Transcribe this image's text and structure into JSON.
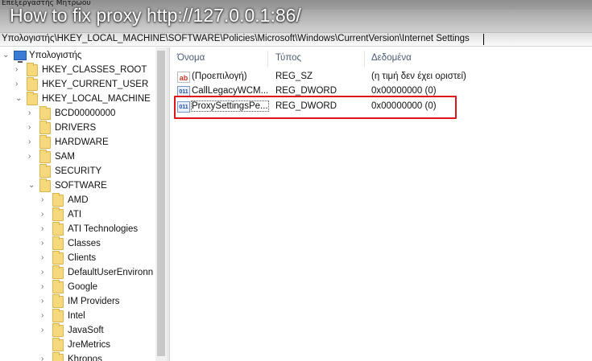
{
  "window": {
    "title": "Επεξεργαστής Μητρώου"
  },
  "video_title": "How to fix proxy http://127.0.0.1:86/",
  "address": "Υπολογιστής\\HKEY_LOCAL_MACHINE\\SOFTWARE\\Policies\\Microsoft\\Windows\\CurrentVersion\\Internet Settings",
  "tree": [
    {
      "label": "Υπολογιστής",
      "depth": 0,
      "chev": "v",
      "icon": "computer"
    },
    {
      "label": "HKEY_CLASSES_ROOT",
      "depth": 1,
      "chev": ">",
      "icon": "folder"
    },
    {
      "label": "HKEY_CURRENT_USER",
      "depth": 1,
      "chev": ">",
      "icon": "folder"
    },
    {
      "label": "HKEY_LOCAL_MACHINE",
      "depth": 1,
      "chev": "v",
      "icon": "folder"
    },
    {
      "label": "BCD00000000",
      "depth": 2,
      "chev": ">",
      "icon": "folder"
    },
    {
      "label": "DRIVERS",
      "depth": 2,
      "chev": ">",
      "icon": "folder"
    },
    {
      "label": "HARDWARE",
      "depth": 2,
      "chev": ">",
      "icon": "folder"
    },
    {
      "label": "SAM",
      "depth": 2,
      "chev": ">",
      "icon": "folder"
    },
    {
      "label": "SECURITY",
      "depth": 2,
      "chev": "",
      "icon": "folder"
    },
    {
      "label": "SOFTWARE",
      "depth": 2,
      "chev": "v",
      "icon": "folder"
    },
    {
      "label": "AMD",
      "depth": 3,
      "chev": ">",
      "icon": "folder"
    },
    {
      "label": "ATI",
      "depth": 3,
      "chev": ">",
      "icon": "folder"
    },
    {
      "label": "ATI Technologies",
      "depth": 3,
      "chev": ">",
      "icon": "folder"
    },
    {
      "label": "Classes",
      "depth": 3,
      "chev": ">",
      "icon": "folder"
    },
    {
      "label": "Clients",
      "depth": 3,
      "chev": ">",
      "icon": "folder"
    },
    {
      "label": "DefaultUserEnvironn",
      "depth": 3,
      "chev": ">",
      "icon": "folder"
    },
    {
      "label": "Google",
      "depth": 3,
      "chev": ">",
      "icon": "folder"
    },
    {
      "label": "IM Providers",
      "depth": 3,
      "chev": ">",
      "icon": "folder"
    },
    {
      "label": "Intel",
      "depth": 3,
      "chev": ">",
      "icon": "folder"
    },
    {
      "label": "JavaSoft",
      "depth": 3,
      "chev": ">",
      "icon": "folder"
    },
    {
      "label": "JreMetrics",
      "depth": 3,
      "chev": "",
      "icon": "folder"
    },
    {
      "label": "Khronos",
      "depth": 3,
      "chev": ">",
      "icon": "folder"
    }
  ],
  "list": {
    "headers": [
      "Όνομα",
      "Τύπος",
      "Δεδομένα"
    ],
    "rows": [
      {
        "icon": "string-value-icon",
        "glyph": "ab",
        "name": "(Προεπιλογή)",
        "type": "REG_SZ",
        "data": "(η τιμή δεν έχει οριστεί)"
      },
      {
        "icon": "dword-value-icon",
        "glyph": "011",
        "name": "CallLegacyWCM...",
        "type": "REG_DWORD",
        "data": "0x00000000 (0)"
      },
      {
        "icon": "dword-value-icon",
        "glyph": "011",
        "name": "ProxySettingsPe...",
        "type": "REG_DWORD",
        "data": "0x00000000 (0)"
      }
    ]
  },
  "colors": {
    "highlight": "#e0141b",
    "header_text": "#4a5b74",
    "folder": "#f6d97a"
  }
}
